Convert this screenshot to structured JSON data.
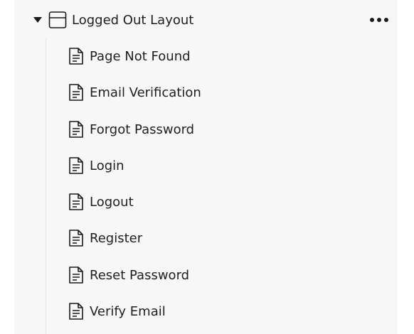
{
  "tree": {
    "group": {
      "label": "Logged Out Layout",
      "expanded": true,
      "icon": "layout-icon",
      "more_icon": "more-horizontal-icon"
    },
    "items": [
      {
        "label": "Page Not Found",
        "icon": "document-icon"
      },
      {
        "label": "Email Verification",
        "icon": "document-icon"
      },
      {
        "label": "Forgot Password",
        "icon": "document-icon"
      },
      {
        "label": "Login",
        "icon": "document-icon"
      },
      {
        "label": "Logout",
        "icon": "document-icon"
      },
      {
        "label": "Register",
        "icon": "document-icon"
      },
      {
        "label": "Reset Password",
        "icon": "document-icon"
      },
      {
        "label": "Verify Email",
        "icon": "document-icon"
      }
    ]
  }
}
